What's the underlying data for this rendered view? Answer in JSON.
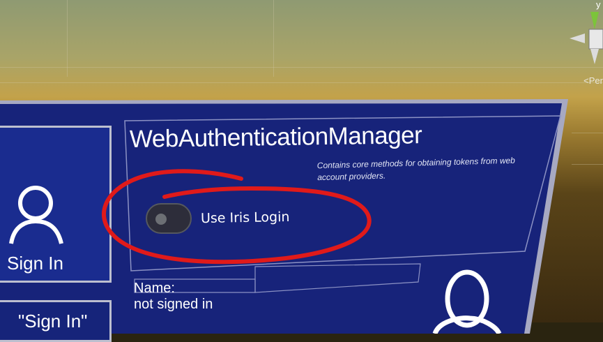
{
  "scene": {
    "axis_label": "y",
    "perspective_label": "<Per"
  },
  "header": {
    "title": "WebAuthenticationManager",
    "description": "Contains core methods for obtaining tokens from web account providers."
  },
  "toggle": {
    "label": "Use Iris Login",
    "state": "off"
  },
  "sign_in_button": {
    "label": "Sign In",
    "icon": "user-icon"
  },
  "sign_in_quoted_button": {
    "label": "\"Sign In\""
  },
  "user_status": {
    "name_label": "Name:",
    "status": "not signed in",
    "icon": "user-icon"
  },
  "annotation": {
    "color": "#e01a1a"
  }
}
